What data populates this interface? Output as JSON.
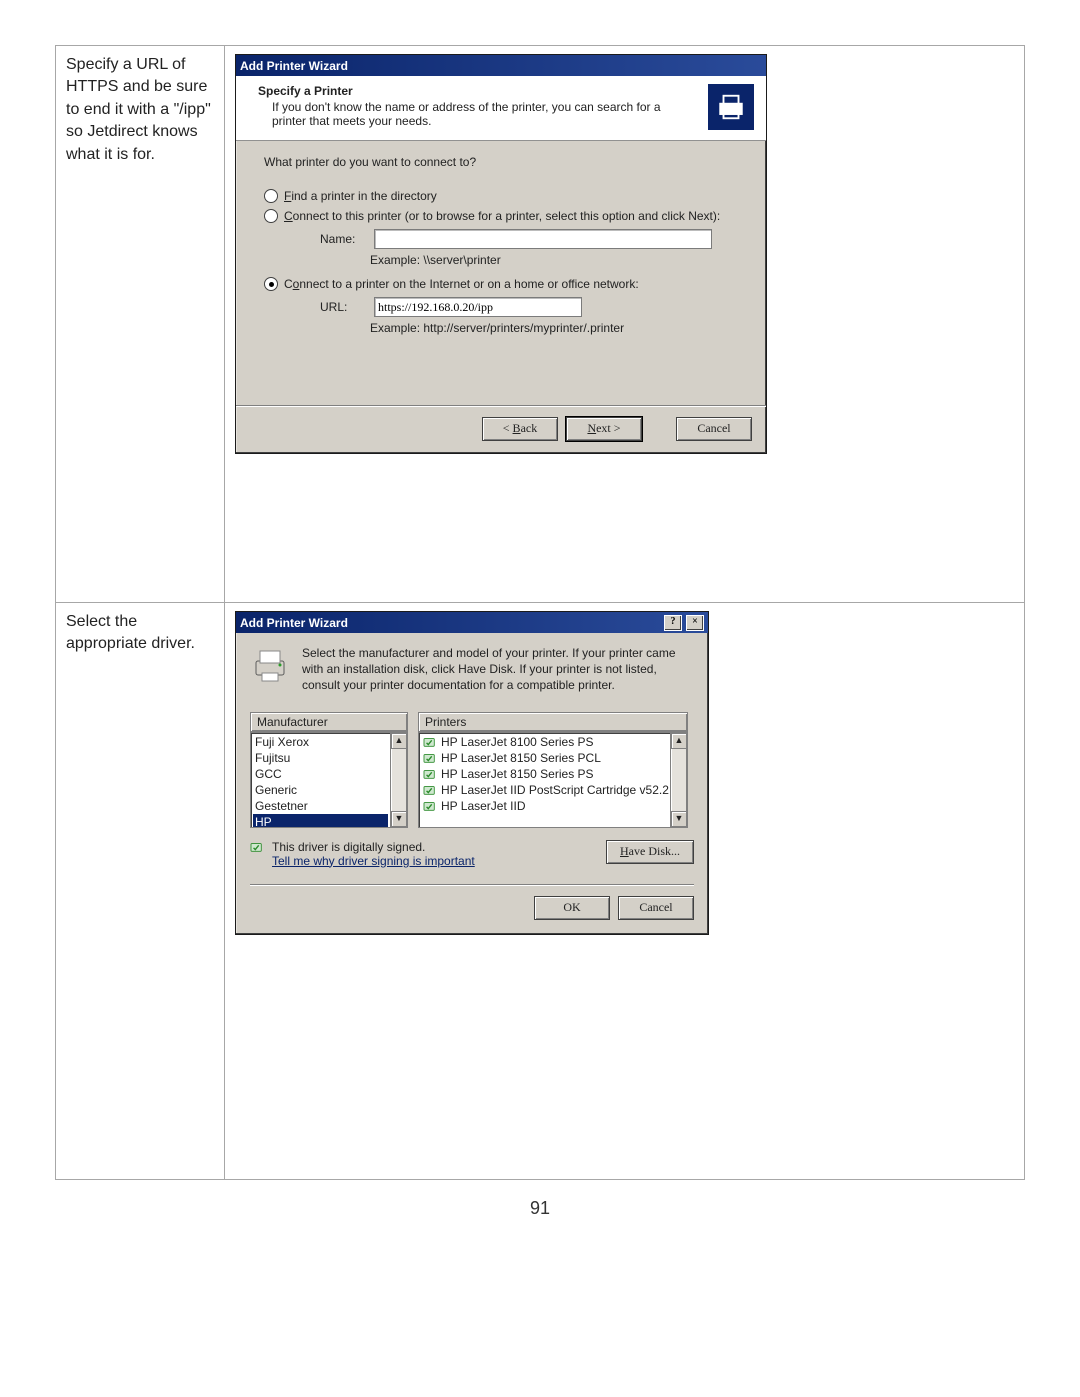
{
  "page_number": "91",
  "row1": {
    "instruction": "Specify a URL of HTTPS and be sure to end it with a \"/ipp\" so Jetdirect knows what it is for.",
    "dialog": {
      "title": "Add Printer Wizard",
      "heading": "Specify a Printer",
      "sub": "If you don't know the name or address of the printer, you can search for a printer that meets your needs.",
      "prompt": "What printer do you want to connect to?",
      "opt_find": "Find a printer in the directory",
      "opt_connect": "Connect to this printer (or to browse for a printer, select this option and click Next):",
      "name_label": "Name:",
      "name_value": "",
      "name_example": "Example: \\\\server\\printer",
      "opt_url": "Connect to a printer on the Internet or on a home or office network:",
      "url_label": "URL:",
      "url_value": "https://192.168.0.20/ipp",
      "url_example": "Example: http://server/printers/myprinter/.printer",
      "btn_back": "< Back",
      "btn_next": "Next >",
      "btn_cancel": "Cancel",
      "find_u": "F",
      "connect_u": "C",
      "url_u": "o",
      "back_u": "B",
      "next_u": "N"
    }
  },
  "row2": {
    "instruction": "Select the appropriate driver.",
    "dialog": {
      "title": "Add Printer Wizard",
      "intro": "Select the manufacturer and model of your printer. If your printer came with an installation disk, click Have Disk. If your printer is not listed, consult your printer documentation for a compatible printer.",
      "mfg_header": "Manufacturer",
      "pr_header": "Printers",
      "manufacturers": [
        "Fuji Xerox",
        "Fujitsu",
        "GCC",
        "Generic",
        "Gestetner",
        "HP"
      ],
      "mfg_selected_index": 5,
      "printers": [
        "HP LaserJet 8100 Series PS",
        "HP LaserJet 8150 Series PCL",
        "HP LaserJet 8150 Series PS",
        "HP LaserJet IID PostScript Cartridge v52.2",
        "HP LaserJet IID"
      ],
      "signed_text": "This driver is digitally signed.",
      "signed_link": "Tell me why driver signing is important",
      "btn_havedisk": "Have Disk...",
      "btn_ok": "OK",
      "btn_cancel": "Cancel",
      "havedisk_u": "H"
    }
  }
}
